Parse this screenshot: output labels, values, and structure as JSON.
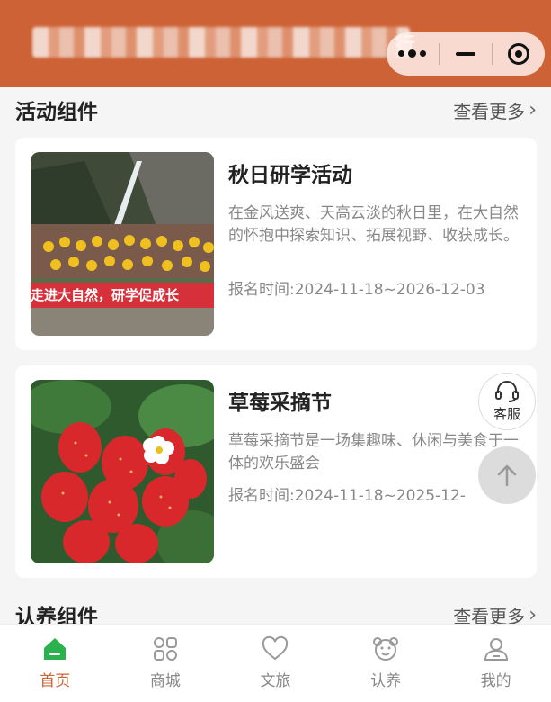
{
  "header": {
    "title_visible_end": "行",
    "capsule": {
      "more_icon": "more-dots-icon",
      "minimize_icon": "minus-icon",
      "close_icon": "target-icon"
    },
    "bg_color": "#cc6235"
  },
  "activity_section": {
    "title": "活动组件",
    "more": "查看更多",
    "items": [
      {
        "title": "秋日研学活动",
        "desc": "在金风送爽、天高云淡的秋日里，在大自然的怀抱中探索知识、拓展视野、收获成长。",
        "date": "报名时间:2024-11-18~2026-12-03",
        "banner": "走进大自然，研学促成长"
      },
      {
        "title": "草莓采摘节",
        "desc": "草莓采摘节是一场集趣味、休闲与美食于一体的欢乐盛会",
        "date": "报名时间:2024-11-18~2025-12-"
      }
    ]
  },
  "adopt_section": {
    "title": "认养组件",
    "more": "查看更多"
  },
  "floating": {
    "service_label": "客服",
    "service_icon": "headset-icon",
    "top_icon": "arrow-up-icon"
  },
  "tabbar": {
    "active_color": "#cc6235",
    "items": [
      {
        "label": "首页",
        "icon": "home-icon"
      },
      {
        "label": "商城",
        "icon": "grid-icon"
      },
      {
        "label": "文旅",
        "icon": "heart-icon"
      },
      {
        "label": "认养",
        "icon": "bear-icon"
      },
      {
        "label": "我的",
        "icon": "user-icon"
      }
    ]
  }
}
